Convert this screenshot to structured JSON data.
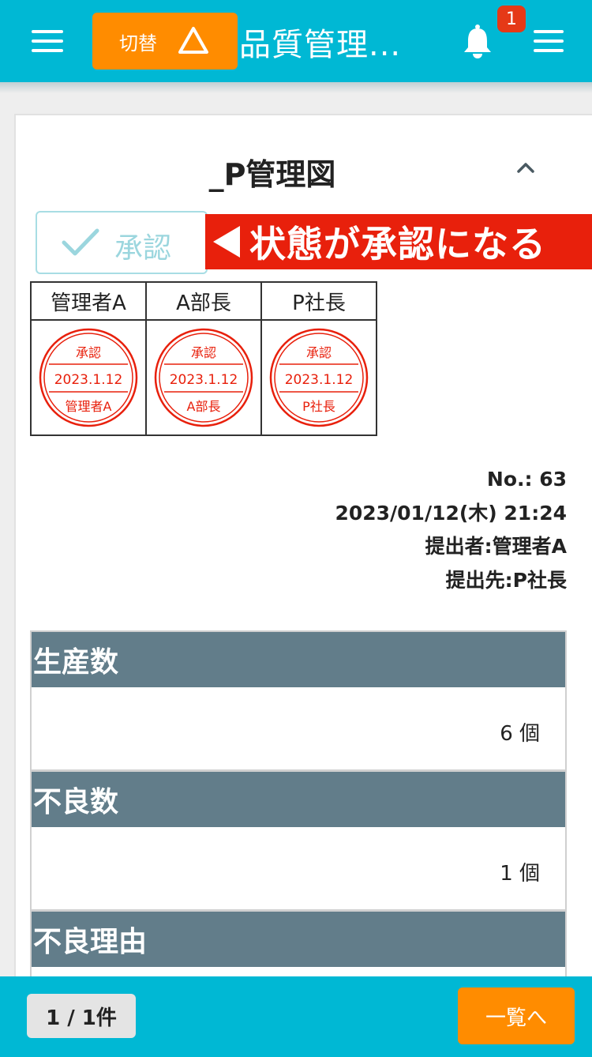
{
  "header": {
    "switch_label": "切替",
    "app_title": "品質管理...",
    "notification_count": "1"
  },
  "card": {
    "title": "_P管理図",
    "approve_label": "承認",
    "callout": "状態が承認になる"
  },
  "stamps": [
    {
      "header": "管理者A",
      "status": "承認",
      "date": "2023.1.12",
      "name": "管理者A"
    },
    {
      "header": "A部長",
      "status": "承認",
      "date": "2023.1.12",
      "name": "A部長"
    },
    {
      "header": "P社長",
      "status": "承認",
      "date": "2023.1.12",
      "name": "P社長"
    }
  ],
  "meta": {
    "number": "No.: 63",
    "datetime": "2023/01/12(木) 21:24",
    "submitter": "提出者:管理者A",
    "recipient": "提出先:P社長"
  },
  "fields": [
    {
      "label": "生産数",
      "value": "6 個"
    },
    {
      "label": "不良数",
      "value": "1 個"
    },
    {
      "label": "不良理由",
      "value": ""
    }
  ],
  "footer": {
    "page_count": "1 / 1件",
    "list_button": "一覧へ"
  },
  "colors": {
    "header": "#00b8d4",
    "accent": "#ff8c00",
    "stamp": "#e8200c",
    "field_header": "#627d8a"
  }
}
